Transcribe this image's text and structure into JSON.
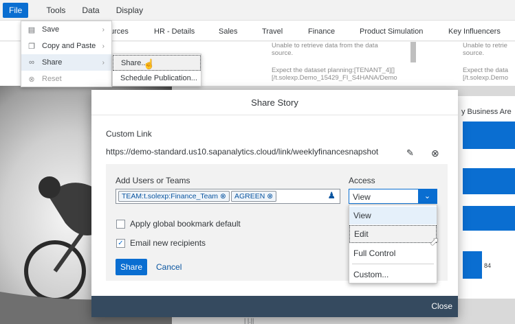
{
  "menubar": {
    "items": [
      "File",
      "Tools",
      "Data",
      "Display"
    ]
  },
  "tabs": [
    "urces",
    "HR - Details",
    "Sales",
    "Travel",
    "Finance",
    "Product Simulation",
    "Key Influencers"
  ],
  "background": {
    "msg1_line1": "Unable to retrieve data from the data",
    "msg1_line2": "source.",
    "msg1_line3": "Expect the dataset planning:[TENANT_4][]",
    "msg1_line4": "[/t.solexp.Demo_15429_FI_S4HANA/Demo",
    "msg2_line1": "Unable to retrie",
    "msg2_line2": "source.",
    "msg2_line3": "Expect the data",
    "msg2_line4": "[/t.solexp.Demo",
    "chart_title": "y Business Are",
    "bar_value": "84",
    "bottom_fragment": "| |.||"
  },
  "file_menu": {
    "items": [
      {
        "label": "Save",
        "icon": "save-icon",
        "arrow": true
      },
      {
        "label": "Copy and Paste",
        "icon": "copy-icon",
        "arrow": true
      },
      {
        "label": "Share",
        "icon": "share-icon",
        "arrow": true
      },
      {
        "label": "Reset",
        "icon": "reset-icon",
        "arrow": false
      }
    ]
  },
  "share_submenu": {
    "items": [
      "Share...",
      "Schedule Publication..."
    ]
  },
  "dialog": {
    "title": "Share Story",
    "custom_link_label": "Custom Link",
    "custom_link_url": "https://demo-standard.us10.sapanalytics.cloud/link/weeklyfinancesnapshot",
    "users_label": "Add Users or Teams",
    "tokens": [
      "TEAM:t.solexp:Finance_Team",
      "AGREEN"
    ],
    "access_label": "Access",
    "access_value": "View",
    "bookmark_label": "Apply global bookmark default",
    "email_label": "Email new recipients",
    "share_button": "Share",
    "cancel_button": "Cancel",
    "close_button": "Close"
  },
  "access_options": [
    "View",
    "Edit",
    "Full Control",
    "Custom..."
  ]
}
